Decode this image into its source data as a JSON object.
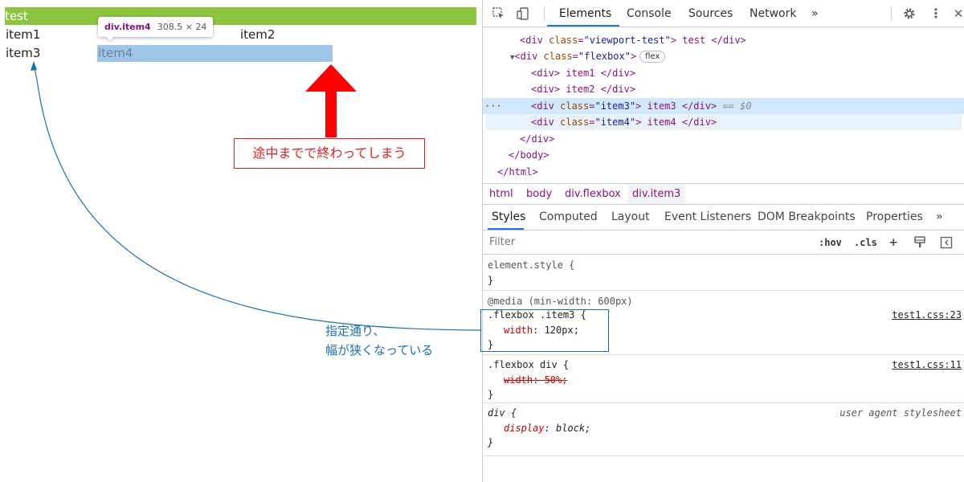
{
  "page": {
    "banner_text": "test",
    "item1": "item1",
    "item2": "item2",
    "item3": "item3",
    "item4": "item4",
    "tooltip": {
      "tag": "div.item4",
      "dims": "308.5 × 24"
    },
    "note_red": "途中までで終わってしまう",
    "note_blue_line1": "指定通り、",
    "note_blue_line2": "幅が狭くなっている"
  },
  "devtools": {
    "tabs": [
      "Elements",
      "Console",
      "Sources",
      "Network",
      "»"
    ],
    "active_tab": "Elements",
    "icons": {
      "inspect": "inspect-element-icon",
      "device": "device-toolbar-icon",
      "settings": "gear-icon",
      "menu": "kebab-menu-icon",
      "close": "close-icon"
    },
    "dom": {
      "l1": {
        "tag_open": "<div ",
        "attr": "class",
        "val": "\"viewport-test\"",
        "text": "> test </div>"
      },
      "l2": {
        "arrow": "▼",
        "tag_open": "<div ",
        "attr": "class",
        "val": "\"flexbox\"",
        "close": ">",
        "badge": "flex"
      },
      "l3": "<div> item1 </div>",
      "l4": "<div> item2 </div>",
      "l5": {
        "dots": "···",
        "tag_open": "<div ",
        "attr": "class",
        "val": "\"item3\"",
        "text": "> item3 </div>",
        "eq": " == $0"
      },
      "l6": {
        "tag_open": "<div ",
        "attr": "class",
        "val": "\"item4\"",
        "text": "> item4 </div>"
      },
      "l7": "</div>",
      "l8": "</body>",
      "l9": "</html>"
    },
    "breadcrumbs": [
      "html",
      "body",
      "div.flexbox",
      "div.item3"
    ],
    "subtabs": [
      "Styles",
      "Computed",
      "Layout",
      "Event Listeners",
      "DOM Breakpoints",
      "Properties",
      "»"
    ],
    "filter_placeholder": "Filter",
    "filter_buttons": {
      "hov": ":hov",
      "cls": ".cls",
      "plus": "+"
    },
    "rules": {
      "element_style": {
        "selector": "element.style {",
        "close": "}"
      },
      "media": "@media (min-width: 600px)",
      "item3": {
        "selector": ".flexbox .item3 {",
        "prop": "width",
        "value": "120px;",
        "source": "test1.css:23",
        "close": "}"
      },
      "div": {
        "selector": ".flexbox div {",
        "prop": "width",
        "value": "50%;",
        "source": "test1.css:11",
        "close": "}"
      },
      "ua": {
        "selector": "div {",
        "prop": "display",
        "value": "block;",
        "source": "user agent stylesheet",
        "close": "}"
      }
    }
  },
  "colors": {
    "banner": "#8cc63f",
    "highlight": "#9fc5e8",
    "red": "#e02020",
    "blue": "#1a6fb0",
    "accent": "#1a73e8"
  }
}
